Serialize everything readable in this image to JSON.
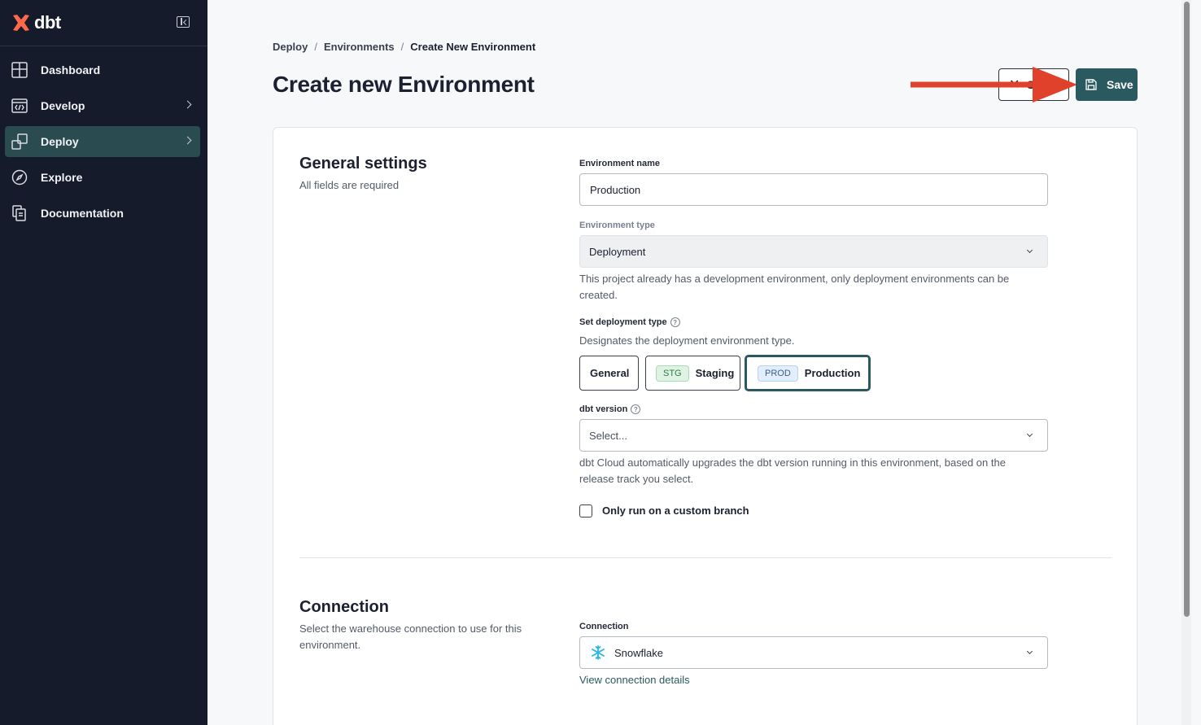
{
  "brand": {
    "name": "dbt"
  },
  "sidebar": {
    "items": [
      {
        "label": "Dashboard",
        "icon": "grid-icon",
        "chevron": false
      },
      {
        "label": "Develop",
        "icon": "code-icon",
        "chevron": true
      },
      {
        "label": "Deploy",
        "icon": "deploy-icon",
        "chevron": true,
        "active": true
      },
      {
        "label": "Explore",
        "icon": "compass-icon",
        "chevron": false
      },
      {
        "label": "Documentation",
        "icon": "docs-icon",
        "chevron": false
      }
    ]
  },
  "breadcrumb": {
    "items": [
      "Deploy",
      "Environments",
      "Create New Environment"
    ],
    "separator": "/"
  },
  "page": {
    "title": "Create new Environment"
  },
  "header_actions": {
    "cancel_label": "C",
    "save_label": "Save"
  },
  "general": {
    "title": "General settings",
    "subtitle": "All fields are required",
    "env_name_label": "Environment name",
    "env_name_value": "Production",
    "env_type_label": "Environment type",
    "env_type_value": "Deployment",
    "env_type_helper": "This project already has a development environment, only deployment environments can be created.",
    "deploy_type_label": "Set deployment type",
    "deploy_type_helper": "Designates the deployment environment type.",
    "deploy_types": [
      {
        "label": "General",
        "tag": ""
      },
      {
        "label": "Staging",
        "tag": "STG"
      },
      {
        "label": "Production",
        "tag": "PROD",
        "selected": true
      }
    ],
    "dbt_version_label": "dbt version",
    "dbt_version_placeholder": "Select...",
    "dbt_version_helper": "dbt Cloud automatically upgrades the dbt version running in this environment, based on the release track you select.",
    "custom_branch_label": "Only run on a custom branch",
    "custom_branch_checked": false
  },
  "connection": {
    "title": "Connection",
    "subtitle": "Select the warehouse connection to use for this environment.",
    "label": "Connection",
    "value": "Snowflake",
    "link": "View connection details"
  },
  "colors": {
    "sidebar_bg": "#151b2b",
    "accent": "#2a5a60",
    "annotation_arrow": "#e0412a",
    "brand_orange": "#ff694a"
  }
}
